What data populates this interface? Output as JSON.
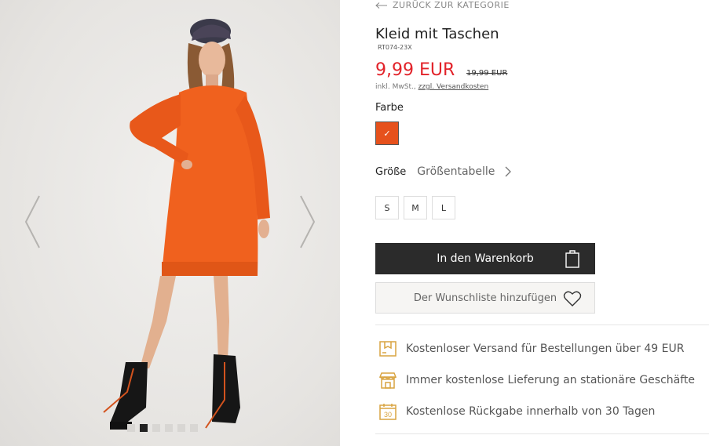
{
  "gallery": {
    "prev_icon": "chevron-left-icon",
    "next_icon": "chevron-right-icon",
    "dots_count": 6,
    "active_dot": 1
  },
  "product": {
    "back_label": "ZURÜCK ZUR KATEGORIE",
    "title": "Kleid mit Taschen",
    "sku": "RT074-23X",
    "price": "9,99 EUR",
    "old_price": "19,99 EUR",
    "vat_prefix": "inkl. MwSt.,",
    "vat_link": "zzgl. Versandkosten",
    "color_label": "Farbe",
    "color_swatch": "#e6511c",
    "size_label": "Größe",
    "size_table": "Größentabelle",
    "sizes": [
      "S",
      "M",
      "L"
    ],
    "cart_button": "In den Warenkorb",
    "wishlist_button": "Der Wunschliste hinzufügen"
  },
  "benefits": [
    {
      "icon": "shipping-box-icon",
      "text": "Kostenloser Versand für Bestellungen über 49 EUR"
    },
    {
      "icon": "store-icon",
      "text": "Immer kostenlose Lieferung an stationäre Geschäfte"
    },
    {
      "icon": "calendar-30-icon",
      "text": "Kostenlose Rückgabe innerhalb von 30 Tagen"
    }
  ],
  "colors": {
    "price_red": "#e2232a",
    "accent_icon": "#d9a441",
    "button_dark": "#2b2b2b"
  }
}
